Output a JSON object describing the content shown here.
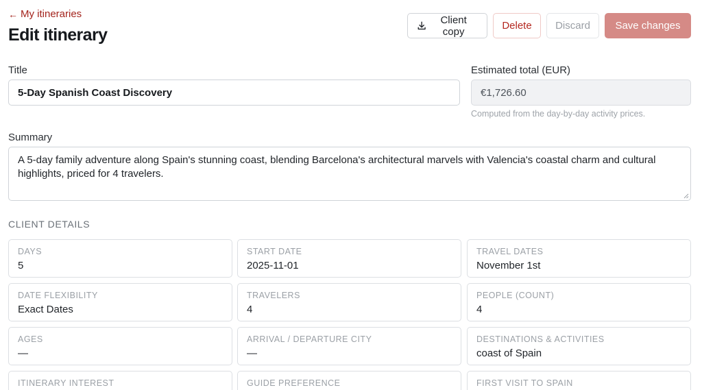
{
  "nav": {
    "back_arrow": "←",
    "back_label": "My itineraries",
    "back_icon": "arrow-left-icon"
  },
  "page": {
    "title": "Edit itinerary"
  },
  "toolbar": {
    "client_copy_label": "Client copy",
    "client_copy_icon": "download-icon",
    "delete_label": "Delete",
    "discard_label": "Discard",
    "save_label": "Save changes"
  },
  "form": {
    "title_label": "Title",
    "title_value": "5-Day Spanish Coast Discovery",
    "total_label": "Estimated total (EUR)",
    "total_value": "€1,726.60",
    "total_help": "Computed from the day-by-day activity prices.",
    "summary_label": "Summary",
    "summary_value": "A 5-day family adventure along Spain's stunning coast, blending Barcelona's architectural marvels with Valencia's coastal charm and cultural highlights, priced for 4 travelers."
  },
  "client_details": {
    "heading": "CLIENT DETAILS",
    "items": [
      {
        "label": "DAYS",
        "value": "5"
      },
      {
        "label": "START DATE",
        "value": "2025-11-01"
      },
      {
        "label": "TRAVEL DATES",
        "value": "November 1st"
      },
      {
        "label": "DATE FLEXIBILITY",
        "value": "Exact Dates"
      },
      {
        "label": "TRAVELERS",
        "value": "4"
      },
      {
        "label": "PEOPLE (COUNT)",
        "value": "4"
      },
      {
        "label": "AGES",
        "value": "—"
      },
      {
        "label": "ARRIVAL / DEPARTURE CITY",
        "value": "—"
      },
      {
        "label": "DESTINATIONS & ACTIVITIES",
        "value": "coast of Spain"
      },
      {
        "label": "ITINERARY INTEREST",
        "value": ""
      },
      {
        "label": "GUIDE PREFERENCE",
        "value": ""
      },
      {
        "label": "FIRST VISIT TO SPAIN",
        "value": ""
      }
    ]
  },
  "colors": {
    "accent": "#a3231c",
    "save_button": "#d58a86",
    "border": "#cfd3d8"
  }
}
